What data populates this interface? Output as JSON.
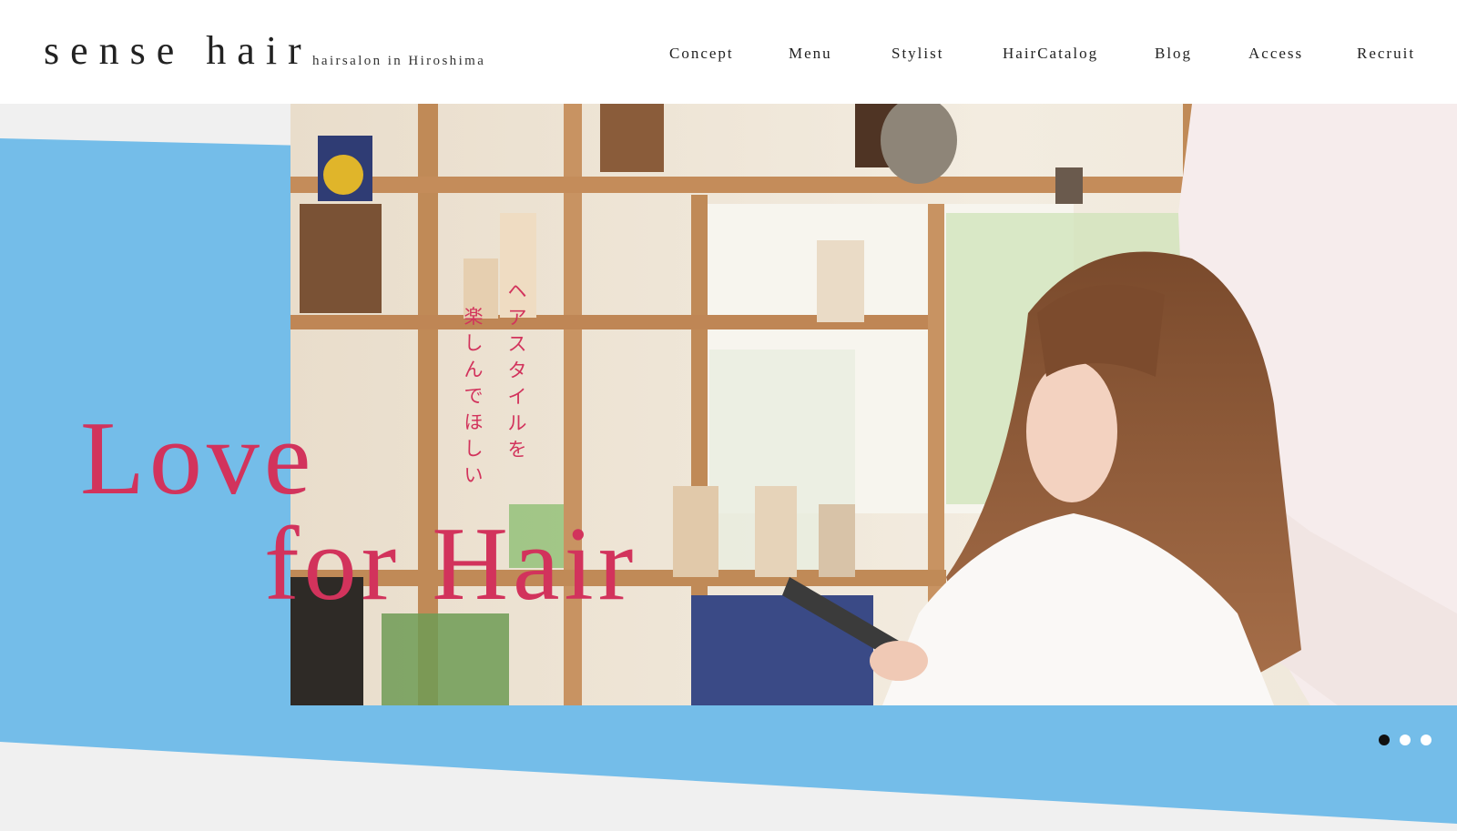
{
  "brand": {
    "logo_text": "sense hair",
    "tagline": "hairsalon in Hiroshima"
  },
  "nav": {
    "items": [
      {
        "label": "Concept"
      },
      {
        "label": "Menu"
      },
      {
        "label": "Stylist"
      },
      {
        "label": "HairCatalog"
      },
      {
        "label": "Blog"
      },
      {
        "label": "Access"
      },
      {
        "label": "Recruit"
      }
    ]
  },
  "hero": {
    "headline_line1": "Love",
    "headline_line2": "for Hair",
    "vertical_line1": "ヘアスタイルを",
    "vertical_line2": "楽しんでほしい",
    "image_description": "photo-stylist-cutting-hair",
    "slider": {
      "total": 3,
      "active_index": 0
    }
  },
  "colors": {
    "accent_blue": "#74bde9",
    "headline_pink": "#d2335c",
    "background_gray": "#f0f0f0",
    "text_dark": "#222222"
  }
}
